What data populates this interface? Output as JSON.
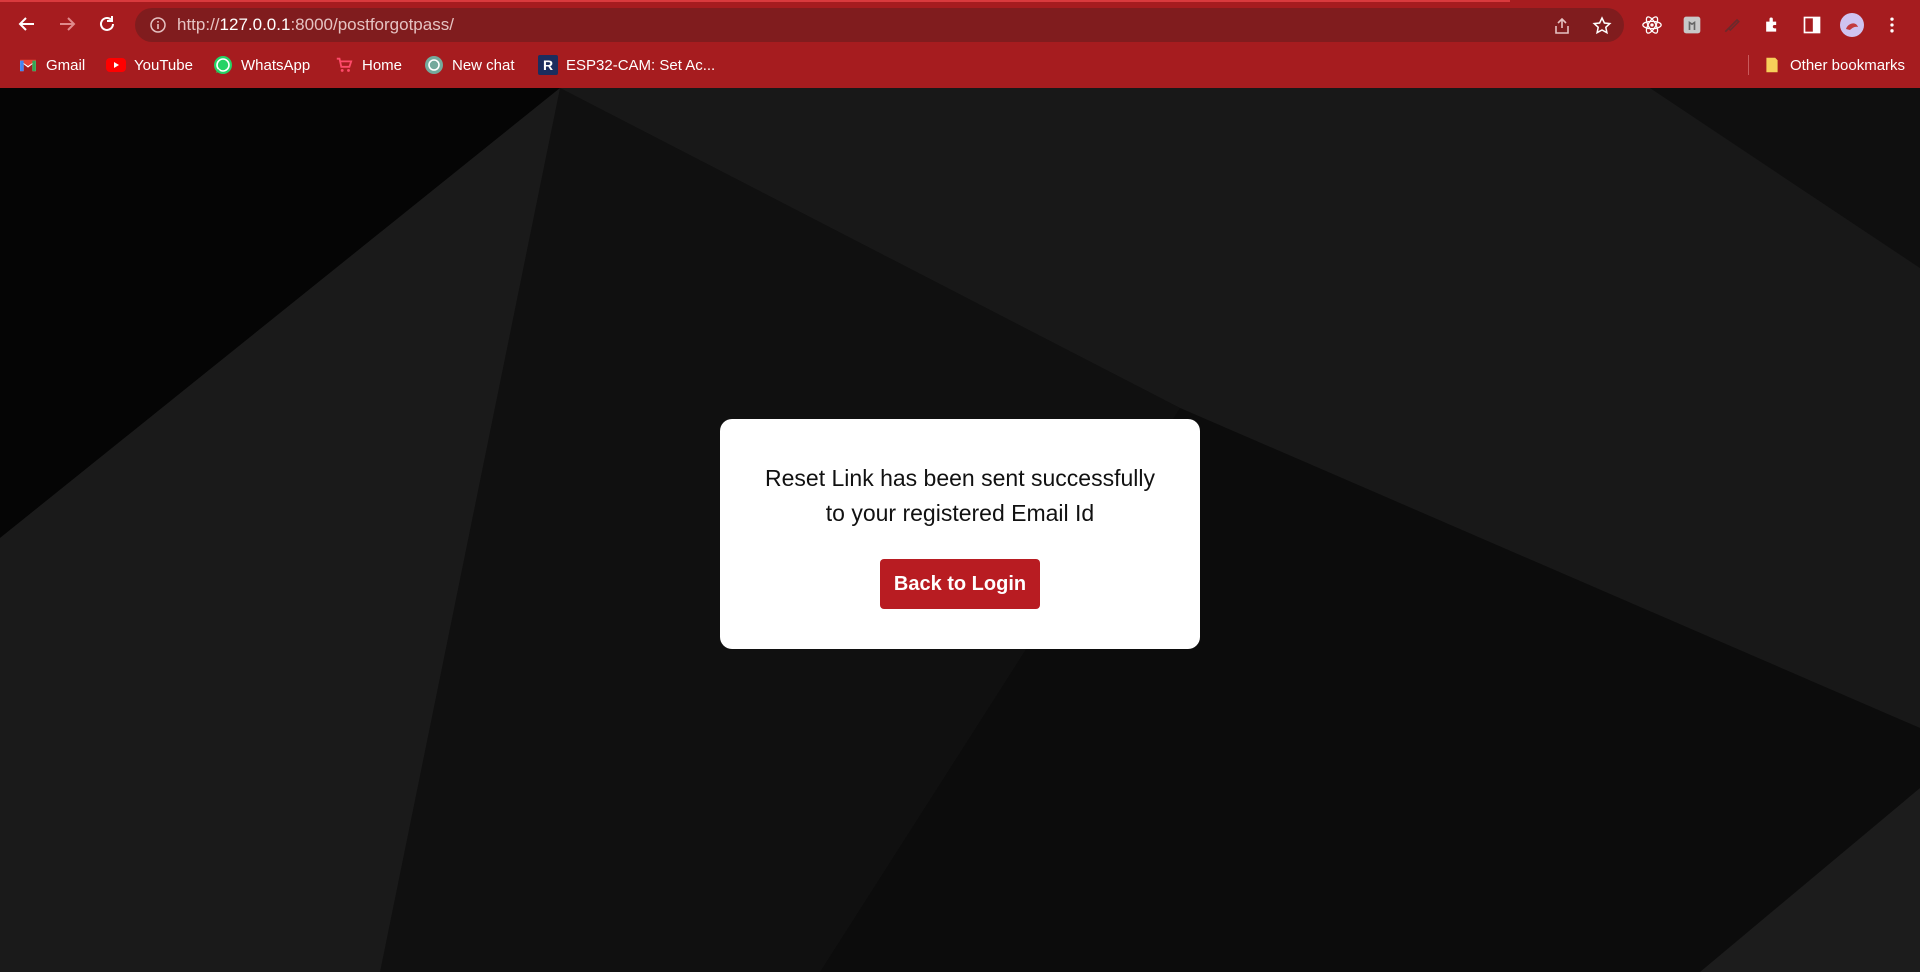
{
  "browser": {
    "url_prefix": "http://",
    "url_host": "127.0.0.1",
    "url_rest": ":8000/postforgotpass/",
    "bookmarks": [
      {
        "label": "Gmail",
        "icon": "gmail-icon"
      },
      {
        "label": "YouTube",
        "icon": "youtube-icon"
      },
      {
        "label": "WhatsApp",
        "icon": "whatsapp-icon"
      },
      {
        "label": "Home",
        "icon": "cart-icon"
      },
      {
        "label": "New chat",
        "icon": "chatgpt-icon"
      },
      {
        "label": "ESP32-CAM: Set Ac...",
        "icon": "r-icon"
      }
    ],
    "other_bookmarks": "Other bookmarks",
    "colors": {
      "chrome": "#a61c1f",
      "omnibox": "#801c1e"
    }
  },
  "card": {
    "message_line1": "Reset Link has been sent successfully",
    "message_line2": "to your registered Email Id",
    "button_label": "Back to Login",
    "button_color": "#b81c22"
  }
}
